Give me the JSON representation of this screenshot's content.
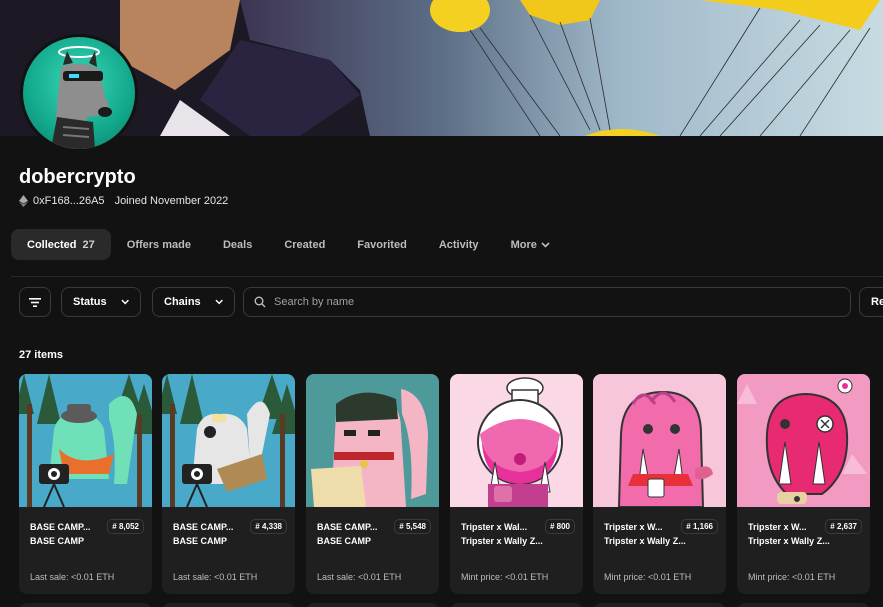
{
  "profile": {
    "username": "dobercrypto",
    "address": "0xF168...26A5",
    "joined": "Joined November 2022"
  },
  "tabs": [
    {
      "label": "Collected",
      "count": "27"
    },
    {
      "label": "Offers made"
    },
    {
      "label": "Deals"
    },
    {
      "label": "Created"
    },
    {
      "label": "Favorited"
    },
    {
      "label": "Activity"
    },
    {
      "label": "More"
    }
  ],
  "filters": {
    "status_label": "Status",
    "chains_label": "Chains",
    "search_placeholder": "Search by name",
    "sort_label": "Re"
  },
  "items_count": "27 items",
  "cards": [
    {
      "name": "BASE CAMP...",
      "number": "# 8,052",
      "collection": "BASE CAMP",
      "sale": "Last sale: <0.01 ETH"
    },
    {
      "name": "BASE CAMP...",
      "number": "# 4,338",
      "collection": "BASE CAMP",
      "sale": "Last sale: <0.01 ETH"
    },
    {
      "name": "BASE CAMP...",
      "number": "# 5,548",
      "collection": "BASE CAMP",
      "sale": "Last sale: <0.01 ETH"
    },
    {
      "name": "Tripster x Wal...",
      "number": "# 800",
      "collection": "Tripster x Wally Z...",
      "sale": "Mint price: <0.01 ETH"
    },
    {
      "name": "Tripster x W...",
      "number": "# 1,166",
      "collection": "Tripster x Wally Z...",
      "sale": "Mint price: <0.01 ETH"
    },
    {
      "name": "Tripster x W...",
      "number": "# 2,637",
      "collection": "Tripster x Wally Z...",
      "sale": "Mint price: <0.01 ETH"
    }
  ],
  "colors": {
    "background": "#121212",
    "card": "#1f1f1f",
    "border": "#3a3a3a"
  }
}
